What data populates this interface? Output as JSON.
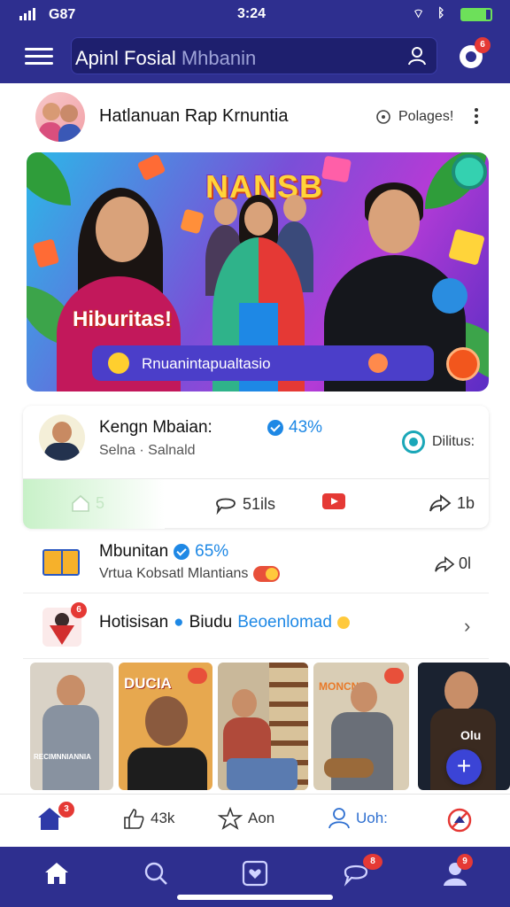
{
  "status_bar": {
    "carrier": "G87",
    "time": "3:24"
  },
  "header": {
    "search_brand": "Apinl Fosial",
    "search_placeholder": "Mhbanin",
    "notification_count": "6"
  },
  "page": {
    "title": "Hatlanuan Rap Krnuntia",
    "pages_label": "Polages!"
  },
  "banner": {
    "title": "NANSB",
    "tagline": "Hiburitas!",
    "cta": "Rnuanintapualtasio"
  },
  "post": {
    "name": "Kengn Mbaian:",
    "percent": "43%",
    "subtitle": "Selna · Salnald",
    "follow_label": "Dilitus:",
    "actions": {
      "like_count": "5",
      "comment_count": "51ils",
      "share_count": "1b"
    }
  },
  "rows": [
    {
      "title": "Mbunitan",
      "percent": "65%",
      "subtitle": "Vrtua Kobsatl Mlantians",
      "share_label": "0l"
    },
    {
      "title": "Hotisisan",
      "link_text": "Biudu",
      "link_accent": "Beoenlomad"
    }
  ],
  "photos": [
    {
      "caption": "RECIMNNIANNIA"
    },
    {
      "caption": "DUCIA"
    },
    {
      "caption": ""
    },
    {
      "caption": "MONCNIR"
    },
    {
      "caption": "Olu"
    }
  ],
  "tabbar": {
    "home_badge": "3",
    "likes_label": "43k",
    "favorites_label": "Aon",
    "profile_label": "Uoh:"
  },
  "bottom_nav": {
    "messages_badge": "8",
    "profile_badge": "9"
  },
  "colors": {
    "brand": "#2e2f8f",
    "accent": "#1e88e5",
    "badge": "#e53935"
  }
}
